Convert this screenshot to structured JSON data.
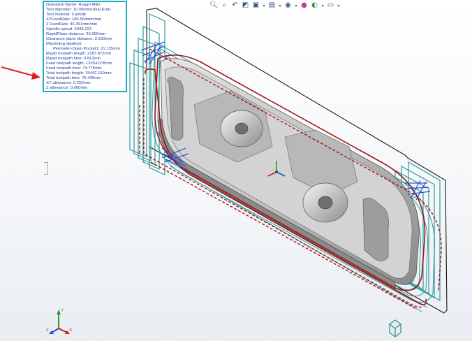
{
  "info_panel": {
    "lines": [
      "Operation Name: Rough Mill1",
      "Tool diameter: 10.000mm(Flat End)",
      "Tool material: Carbide",
      "XYFeedRate: 185.564mm/min",
      "Z FeedRate: 46.391mm/min",
      "Spindle speed: 2435.223",
      "RapidPlane distance: 25.000mm",
      "Clearance plane distance: 2.500mm",
      "Machining depth(s):",
      "Perimeter-Open Pocket1: 21.155mm",
      "Rapid toolpath length: 2187.472mm",
      "Rapid toolpath time: 0.661min",
      "Feed toolpath length: 13254.678mm",
      "Feed toolpath time: 74.775min",
      "Total toolpath length: 15442.150mm",
      "Total toolpath time: 75.436min",
      "XY allowance: 0.250mm",
      "Z allowance: 0.000mm"
    ]
  },
  "toolbar": {
    "icons": [
      "zoom-to-fit-icon",
      "zoom-area-icon",
      "previous-view-icon",
      "section-view-icon",
      "view-orientation-icon",
      "display-style-icon",
      "hide-show-icon",
      "edit-appearance-icon",
      "apply-scene-icon",
      "view-settings-icon"
    ]
  },
  "triad": {
    "x_label": "X",
    "y_label": "Y",
    "z_label": "Z"
  },
  "colors": {
    "panel_border": "#27a7c6",
    "panel_text": "#1f3ea0",
    "toolpath_teal": "#2e9a9a",
    "toolpath_blue": "#2a4fd0",
    "stock_red": "#b01818",
    "annotation_arrow": "#e02020",
    "part_gray": "#c9c9c9"
  }
}
